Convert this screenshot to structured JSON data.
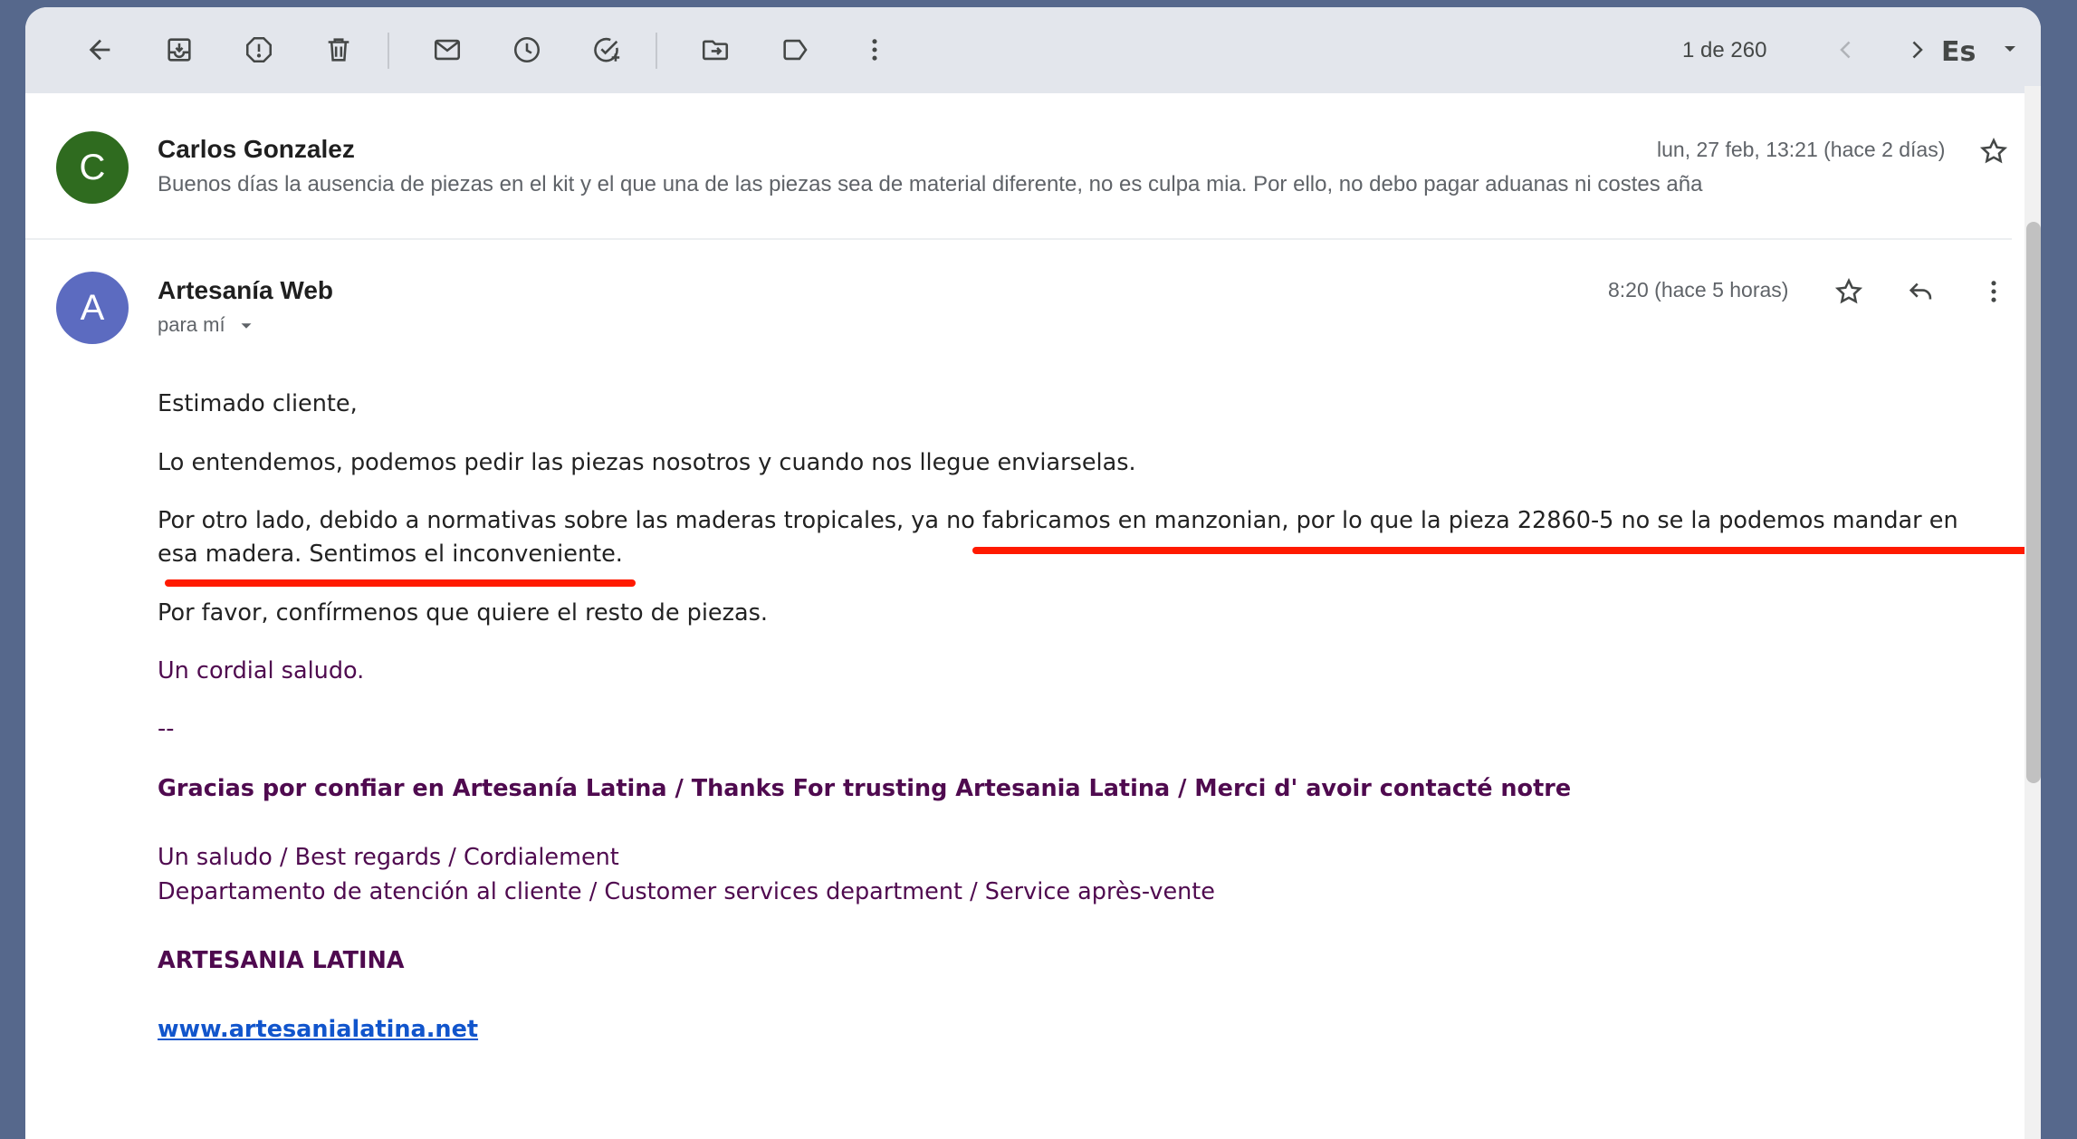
{
  "toolbar": {
    "icons": [
      "back-arrow-icon",
      "archive-icon",
      "report-spam-icon",
      "delete-icon",
      "mark-unread-icon",
      "snooze-icon",
      "add-task-icon",
      "move-to-icon",
      "label-icon",
      "more-vert-icon"
    ],
    "pager": "1 de 260",
    "language": "Es"
  },
  "messages": [
    {
      "avatar_letter": "C",
      "avatar_color": "#2f6b1f",
      "sender": "Carlos Gonzalez",
      "date": "lun, 27 feb, 13:21 (hace 2 días)",
      "snippet": "Buenos días la ausencia de piezas en el kit y el que una de las piezas sea de material diferente, no es culpa mia. Por ello, no debo pagar aduanas ni costes aña"
    },
    {
      "avatar_letter": "A",
      "avatar_color": "#5c6bc0",
      "sender": "Artesanía Web",
      "date": "8:20 (hace 5 horas)",
      "to": "para mí",
      "body": {
        "greeting": "Estimado cliente,",
        "p1": "Lo entendemos, podemos pedir las piezas nosotros y cuando nos llegue enviarselas.",
        "p2_line1": "Por otro lado, debido a normativas sobre las maderas tropicales, ya no fabricamos en manzonian, por lo que la pieza 22860-5 no se la podemos mandar en",
        "p2_line2": "esa madera. Sentimos el inconveniente.",
        "p3": "Por favor, confírmenos que quiere el resto de piezas.",
        "closing": "Un cordial saludo.",
        "sig_sep": "--",
        "sig_thanks": "Gracias por confiar en Artesanía Latina / Thanks For trusting Artesania Latina / Merci d' avoir contacté notre",
        "sig_regards": "Un saludo / Best regards / Cordialement",
        "sig_dept": "Departamento de atención al cliente / Customer services department / Service après-vente",
        "sig_company": "ARTESANIA LATINA",
        "sig_url": "www.artesanialatina.net"
      }
    }
  ],
  "colors": {
    "annotation_underline": "#ff1a00",
    "signature_purple": "#4f0a4f",
    "link_blue": "#1155cc"
  }
}
